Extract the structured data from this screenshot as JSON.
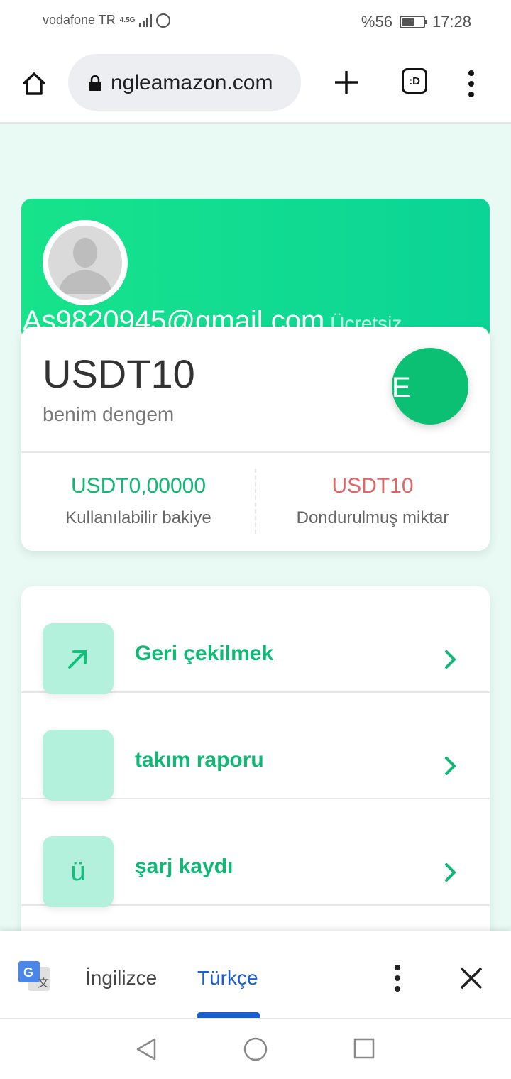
{
  "status_bar": {
    "carrier": "vodafone TR",
    "network": "4.5G",
    "battery_percent": "%56",
    "battery_level": 0.56,
    "time": "17:28"
  },
  "browser": {
    "url": "ngleamazon.com",
    "tabs_label": ":D"
  },
  "profile": {
    "email": "As9820945@gmail.com",
    "tag": "Ücretsiz"
  },
  "balance": {
    "amount": "USDT10",
    "label": "benim dengem",
    "circle_letter": "E",
    "available_value": "USDT0,00000",
    "available_label": "Kullanılabilir bakiye",
    "frozen_value": "USDT10",
    "frozen_label": "Dondurulmuş miktar"
  },
  "menu": {
    "items": [
      {
        "label": "Geri çekilmek",
        "icon": "arrow-up-right-icon",
        "glyph": ""
      },
      {
        "label": "takım raporu",
        "icon": "blank-icon",
        "glyph": ""
      },
      {
        "label": "şarj kaydı",
        "icon": "charge-icon",
        "glyph": "ü"
      }
    ]
  },
  "translate": {
    "source_lang": "İngilizce",
    "target_lang": "Türkçe"
  },
  "colors": {
    "accent_green": "#11b875",
    "frozen_red": "#e06666",
    "translate_blue": "#1a5fd0"
  }
}
